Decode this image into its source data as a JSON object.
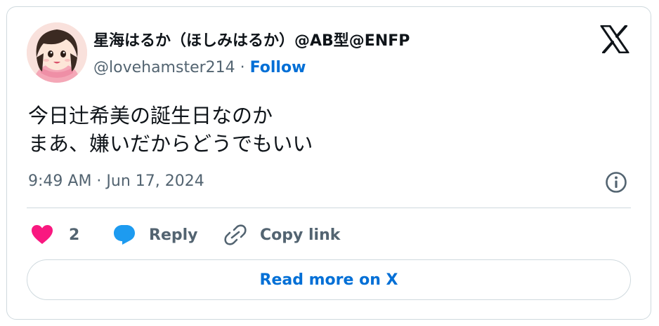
{
  "author": {
    "display_name": "星海はるか（ほしみはるか）@AB型@ENFP",
    "handle": "@lovehamster214",
    "separator": " · ",
    "follow_label": "Follow"
  },
  "tweet": {
    "lines": [
      "今日辻希美の誕生日なのか",
      "まあ、嫌いだからどうでもいい"
    ],
    "timestamp": "9:49 AM · Jun 17, 2024"
  },
  "actions": {
    "like_count": "2",
    "reply_label": "Reply",
    "copy_label": "Copy link"
  },
  "read_more_label": "Read more on X",
  "colors": {
    "link": "#006fd6",
    "like": "#f91880",
    "reply": "#1d9bf0",
    "muted": "#536471",
    "border": "#cfd9de"
  },
  "icons": [
    "avatar-image",
    "x-logo-icon",
    "info-icon",
    "heart-icon",
    "reply-bubble-icon",
    "link-icon"
  ]
}
